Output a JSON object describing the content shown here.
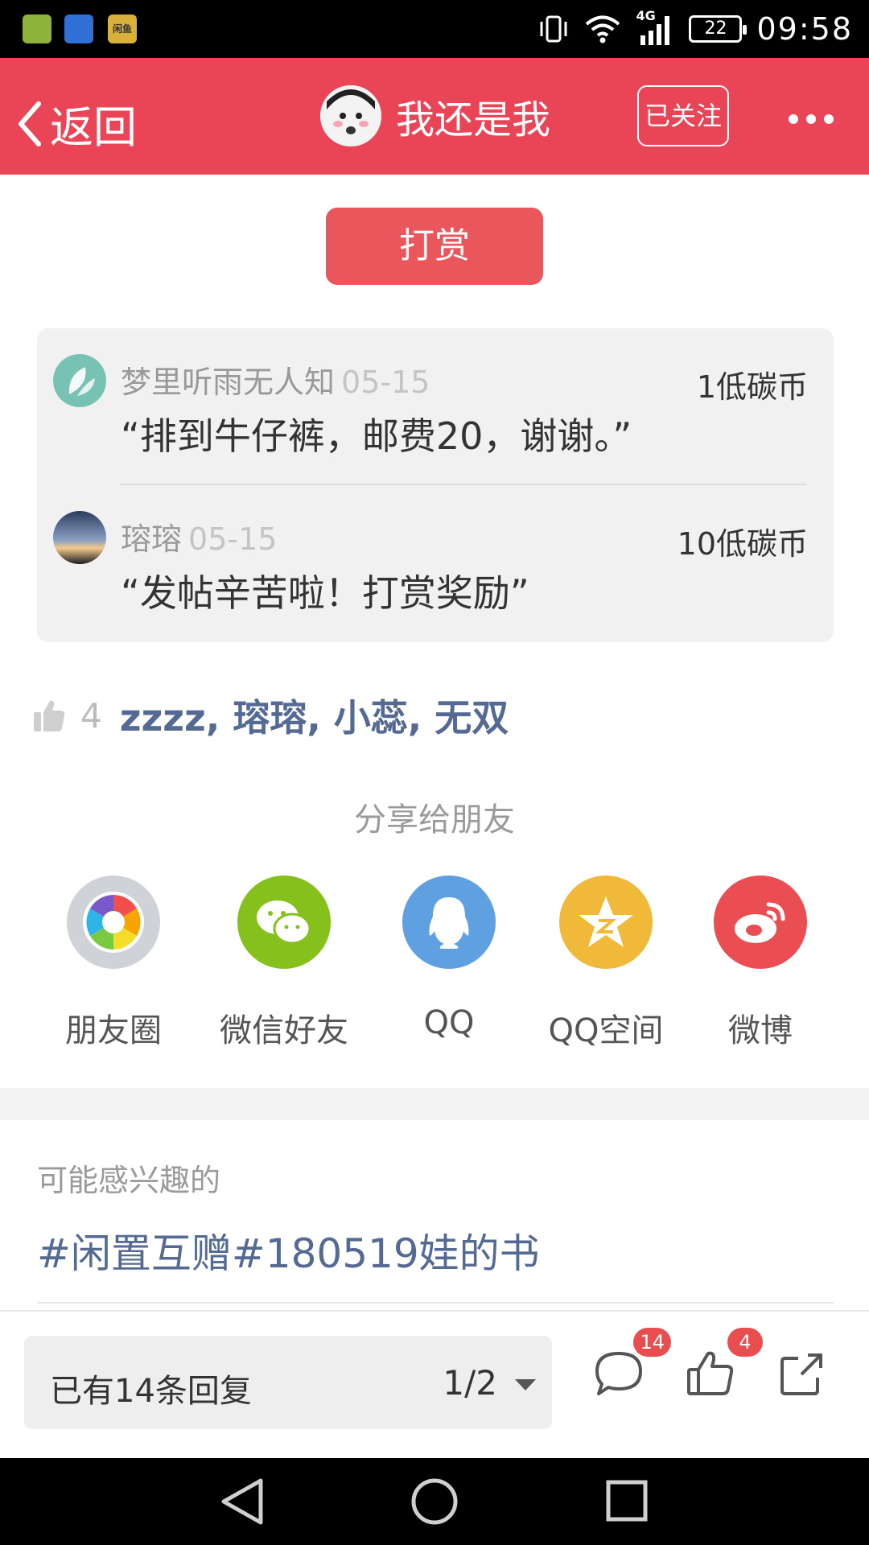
{
  "status_bar": {
    "network": "4G",
    "battery": "22",
    "time": "09:58",
    "app3_label": "闲鱼"
  },
  "header": {
    "back_label": "返回",
    "title": "我还是我",
    "follow_label": "已关注"
  },
  "reward_button_label": "打赏",
  "rewards": [
    {
      "name": "梦里听雨无人知",
      "date": "05-15",
      "amount": "1低碳币",
      "message": "“排到牛仔裤，邮费20，谢谢。”"
    },
    {
      "name": "瑢瑢",
      "date": "05-15",
      "amount": "10低碳币",
      "message": "“发帖辛苦啦！打赏奖励”"
    }
  ],
  "likes": {
    "count": "4",
    "names": "zzzz, 瑢瑢, 小蕊, 无双"
  },
  "share": {
    "title": "分享给朋友",
    "items": [
      {
        "label": "朋友圈",
        "icon": "moments-icon",
        "color": "#cfd2d6"
      },
      {
        "label": "微信好友",
        "icon": "wechat-icon",
        "color": "#86c01d"
      },
      {
        "label": "QQ",
        "icon": "qq-icon",
        "color": "#5ea0e0"
      },
      {
        "label": "QQ空间",
        "icon": "qzone-icon",
        "color": "#f0b93a"
      },
      {
        "label": "微博",
        "icon": "weibo-icon",
        "color": "#ea4d52"
      }
    ]
  },
  "interest": {
    "title": "可能感兴趣的",
    "link": "#闲置互赠#180519娃的书"
  },
  "bottom_bar": {
    "reply_text": "已有14条回复",
    "page": "1/2",
    "comment_badge": "14",
    "like_badge": "4"
  },
  "colors": {
    "header": "#e94557",
    "reward_button": "#e9565c",
    "link": "#546a93",
    "badge": "#ea4d4d"
  }
}
